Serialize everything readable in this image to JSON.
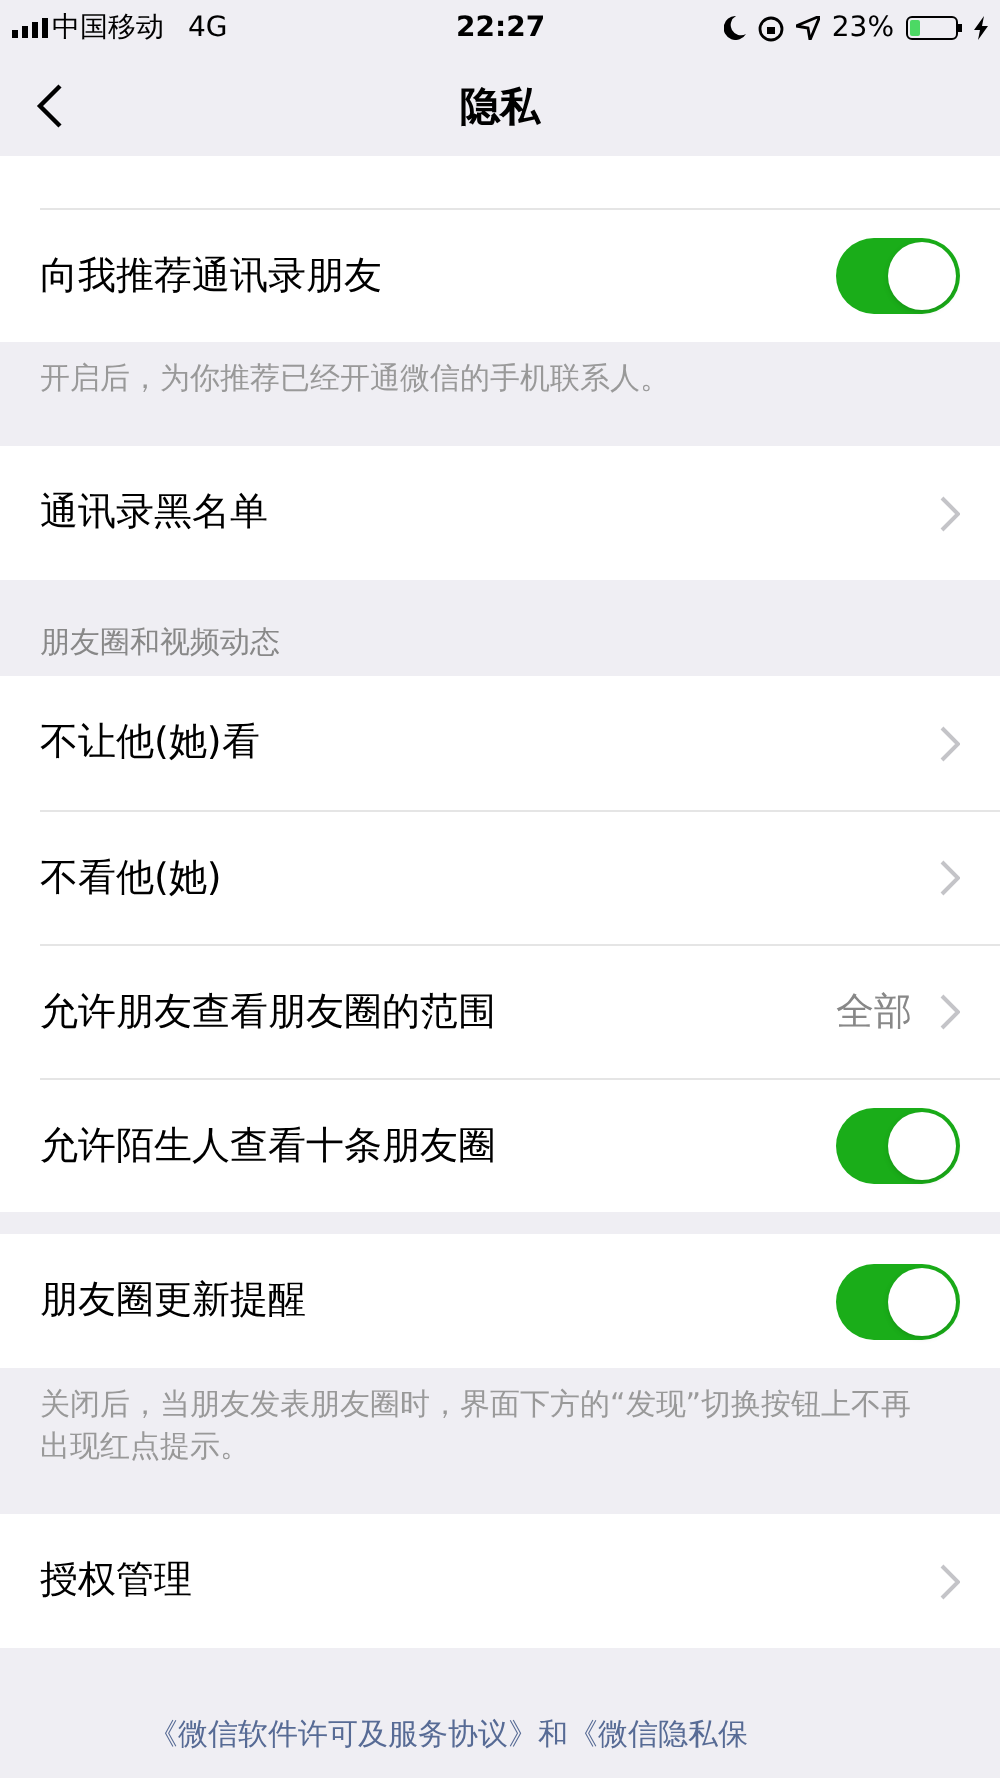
{
  "status_bar": {
    "carrier": "中国移动",
    "network": "4G",
    "time": "22:27",
    "battery": "23%"
  },
  "nav": {
    "title": "隐私"
  },
  "groups": [
    {
      "rows": [
        {
          "kind": "blank"
        },
        {
          "kind": "toggle",
          "label": "向我推荐通讯录朋友",
          "on": true
        }
      ],
      "footer": "开启后，为你推荐已经开通微信的手机联系人。"
    },
    {
      "rows": [
        {
          "kind": "link",
          "label": "通讯录黑名单"
        }
      ]
    },
    {
      "header": "朋友圈和视频动态",
      "rows": [
        {
          "kind": "link",
          "label": "不让他(她)看"
        },
        {
          "kind": "link",
          "label": "不看他(她)"
        },
        {
          "kind": "link",
          "label": "允许朋友查看朋友圈的范围",
          "value": "全部"
        },
        {
          "kind": "toggle",
          "label": "允许陌生人查看十条朋友圈",
          "on": true
        }
      ]
    },
    {
      "rows": [
        {
          "kind": "toggle",
          "label": "朋友圈更新提醒",
          "on": true
        }
      ],
      "footer": "关闭后，当朋友发表朋友圈时，界面下方的“发现”切换按钮上不再出现红点提示。"
    },
    {
      "rows": [
        {
          "kind": "link",
          "label": "授权管理"
        }
      ]
    }
  ],
  "legal": "《微信软件许可及服务协议》和《微信隐私保"
}
